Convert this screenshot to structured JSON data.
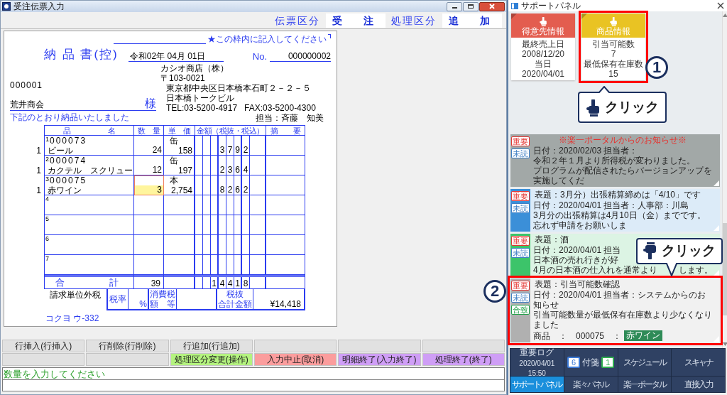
{
  "window": {
    "title": "受注伝票入力"
  },
  "header": {
    "fields": [
      {
        "label": "伝票区分",
        "value": "受　注"
      },
      {
        "label": "処理区分",
        "value": "追　加"
      }
    ]
  },
  "document": {
    "note": "★この枠内に記入してください",
    "title": "納 品 書(控)",
    "date": "令和02年 04月 01日",
    "number_label": "No.",
    "number": "000000002",
    "customer_code": "000001",
    "customer": "荒井商会",
    "honorific": "様",
    "message": "下記のとおり納品いたしました",
    "sender": {
      "company": "カシオ商店（株）",
      "postal": "〒103-0021",
      "address": [
        "東京都中央区日本橋本石町２－２－５",
        "日本橋トークビル"
      ],
      "tel": "TEL:03-5200-4917",
      "fax": "FAX:03-5200-4300",
      "staff": "担当：斉藤　知美"
    },
    "columns": [
      "品　　　　　名",
      "数　量",
      "単　価",
      "金額（税抜・税込）",
      "摘　　要"
    ],
    "rows": [
      {
        "index": "1",
        "marker": "1",
        "code": "000073",
        "name": "ビール",
        "quantity": "24",
        "unit": "缶",
        "price": "158",
        "amount": [
          "3",
          "7",
          "9",
          "2"
        ],
        "selected": false
      },
      {
        "index": "2",
        "marker": "1",
        "code": "000074",
        "name": "カクテル　スクリュー",
        "quantity": "12",
        "unit": "缶",
        "price": "197",
        "amount": [
          "2",
          "3",
          "6",
          "4"
        ],
        "selected": false
      },
      {
        "index": "3",
        "marker": "1",
        "code": "000075",
        "name": "赤ワイン",
        "quantity": "3",
        "unit": "本",
        "price": "2,754",
        "amount": [
          "8",
          "2",
          "6",
          "2"
        ],
        "selected": true
      },
      {
        "index": "4",
        "selected": false
      },
      {
        "index": "5",
        "selected": false
      },
      {
        "index": "6",
        "selected": false
      },
      {
        "index": "7",
        "selected": false
      }
    ],
    "total": {
      "label": "合　　　計",
      "quantity": "39",
      "amount": [
        "1",
        "4",
        "4",
        "1",
        "8"
      ]
    },
    "footer": {
      "tax_mode": "請求単位外税",
      "rate_label": "税率",
      "rate_unit": "%",
      "tax_label": [
        "消費税",
        "額　等"
      ],
      "sum_label": [
        "税抜",
        "合計金額"
      ],
      "sum": "¥14,418"
    },
    "form_code": "コクヨ ウ-332"
  },
  "button_rows": [
    [
      {
        "label": "行挿入(行挿入)",
        "color": "#e1e1e1"
      },
      {
        "label": "行削除(行削除)",
        "color": "#e1e1e1"
      },
      {
        "label": "行追加(行追加)",
        "color": "#e1e1e1"
      },
      {
        "color": "#e1e1e1"
      },
      {
        "color": "#e1e1e1"
      },
      {
        "color": "#e1e1e1"
      }
    ],
    [
      {
        "color": "#e1e1e1"
      },
      {
        "color": "#e1e1e1"
      },
      {
        "label": "処理区分変更(操作)",
        "color": "#b4f37f"
      },
      {
        "label": "入力中止(取消)",
        "color": "#fb9d9d"
      },
      {
        "label": "明細終了(入力終了)",
        "color": "#cf9ef6"
      },
      {
        "label": "処理終了(終了)",
        "color": "#cf9ef6"
      }
    ]
  ],
  "status": {
    "message": "数量を入力してください"
  },
  "support_panel": {
    "title": "サポートパネル",
    "cards": [
      {
        "title": "得意先情報",
        "color": "#e35d4f",
        "lines": [
          "最終売上日",
          "2008/12/20",
          "当日",
          "2020/04/01"
        ]
      },
      {
        "title": "商品情報",
        "color": "#e9c323",
        "lines": [
          "引当可能数",
          "7",
          "最低保有在庫数",
          "15"
        ],
        "callout": {
          "number": "1",
          "text": "クリック"
        }
      }
    ],
    "notices": [
      {
        "kind": "portal",
        "color": "#a2a8a7",
        "title": "※楽一ポータルからのお知らせ※",
        "date": "日付：2020/02/03 担当者：",
        "lines": [
          "令和２年１月より所得税が変わりました。",
          "プログラムが配信されたらバージョンアップを実施してくだ"
        ],
        "badges": [
          {
            "label": "重要",
            "kind": "important"
          },
          {
            "label": "未読",
            "kind": "unread"
          }
        ]
      },
      {
        "kind": "memo",
        "color": "#3b8fd8",
        "title": "表題：3月分）出張精算締めは「4/10」です",
        "date": "日付：2020/04/01 担当者：人事部：川島",
        "lines": [
          "3月分の出張精算は4月10日（金）までです。",
          "忘れず申請をお願いしま"
        ],
        "badges": [
          {
            "label": "重要",
            "kind": "important"
          },
          {
            "label": "未読",
            "kind": "unread"
          }
        ]
      },
      {
        "kind": "memo",
        "color": "#3cc46a",
        "title": "表題：酒",
        "date": "日付：2020/04/01  担当",
        "lines": [
          "日本酒の売れ行きが好",
          [
            "4月の日本酒の仕入れを通常より",
            "します。"
          ]
        ],
        "badges": [
          {
            "label": "重要",
            "kind": "important"
          },
          {
            "label": "未読",
            "kind": "unread"
          }
        ]
      },
      {
        "kind": "system",
        "color": "#b0b0b0",
        "title": "表題：引当可能数確認",
        "date": "日付：2020/04/01 担当者：システムからのお知らせ",
        "lines": [
          "引当可能数量が最低保有在庫数より少なくなりました"
        ],
        "product": {
          "label": "商品　：　000075　：",
          "name": "赤ワイン"
        },
        "badges": [
          {
            "label": "重要",
            "kind": "important"
          },
          {
            "label": "未読",
            "kind": "unread"
          },
          {
            "label": "合致",
            "kind": "match"
          }
        ],
        "callout": {
          "number": "2",
          "text": "クリック"
        }
      }
    ],
    "nav": [
      {
        "kind": "log",
        "lines": [
          "重要ログ",
          "2020/04/01",
          "15:50"
        ],
        "selected": false
      },
      {
        "kind": "sticky",
        "count": "6",
        "label": "付箋",
        "badge": "1",
        "selected": false
      },
      {
        "kind": "plain",
        "label": "スケジュール",
        "selected": false
      },
      {
        "kind": "plain",
        "label": "スキャナ",
        "selected": false
      },
      {
        "kind": "plain",
        "label": "サポートパネル",
        "selected": true
      },
      {
        "kind": "plain",
        "label": "楽々パネル",
        "selected": false
      },
      {
        "kind": "plain",
        "label": "楽一ポータル",
        "selected": false
      },
      {
        "kind": "plain",
        "label": "直接入力",
        "selected": false
      }
    ]
  }
}
